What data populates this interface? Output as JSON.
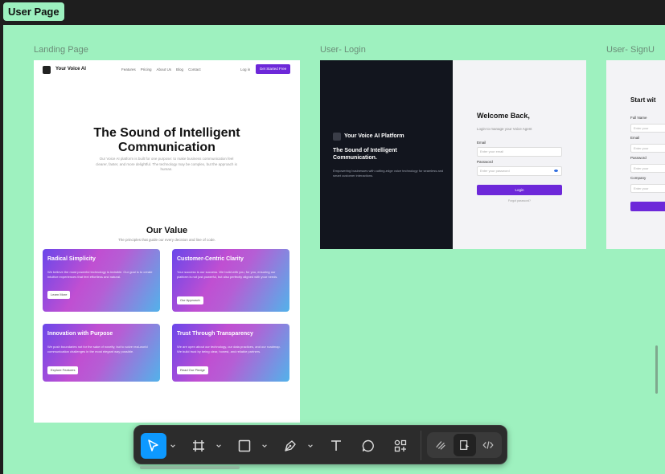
{
  "section_tag": "User Page",
  "frames": {
    "landing_label": "Landing Page",
    "login_label": "User- Login",
    "signup_label": "User- SignU"
  },
  "landing": {
    "brand": "Your Voice AI",
    "nav_links": [
      "Features",
      "Pricing",
      "About Us",
      "Blog",
      "Contact"
    ],
    "login": "Log in",
    "cta": "Get Started Free",
    "hero_line1": "The Sound of Intelligent",
    "hero_line2": "Communication",
    "hero_sub": "Our Voice AI platform is built for one purpose: to make business communication feel clearer, faster, and more delightful. The technology may be complex, but the approach is human.",
    "value_title": "Our Value",
    "value_sub": "The principles that guide our every decision and line of code.",
    "cards": [
      {
        "title": "Radical Simplicity",
        "text": "We believe the most powerful technology is invisible. Our goal is to create intuitive experiences that feel effortless and natural.",
        "button": "Learn More"
      },
      {
        "title": "Customer-Centric Clarity",
        "text": "Your success is our success. We build with you, for you, ensuring our platform is not just powerful, but also perfectly aligned with your needs.",
        "button": "Our Approach"
      },
      {
        "title": "Innovation with Purpose",
        "text": "We push boundaries not for the sake of novelty, but to solve real-world communication challenges in the most elegant way possible.",
        "button": "Explore Features"
      },
      {
        "title": "Trust Through Transparency",
        "text": "We are open about our technology, our data practices, and our roadmap. We build trust by being clear, honest, and reliable partners.",
        "button": "Read Our Pledge"
      }
    ]
  },
  "login": {
    "brand": "Your Voice AI Platform",
    "headline": "The Sound of Intelligent Communication.",
    "desc": "Empowering businesses with cutting-edge voice technology for seamless and smart customer interactions.",
    "title": "Welcome Back,",
    "subtitle": "Login to manage your Voice Agent",
    "email_label": "Email",
    "email_placeholder": "Enter your email",
    "password_label": "Password",
    "password_placeholder": "Enter your password",
    "button": "Login",
    "forgot": "Forgot password?"
  },
  "signup": {
    "title": "Start wit",
    "fields": [
      {
        "label": "Full Name",
        "placeholder": "Enter your"
      },
      {
        "label": "Email",
        "placeholder": "Enter your"
      },
      {
        "label": "Password",
        "placeholder": "Enter your"
      },
      {
        "label": "Company",
        "placeholder": "Enter your"
      }
    ]
  },
  "toolbar": {
    "tools": [
      "move-tool",
      "frame-tool",
      "shape-tool",
      "pen-tool",
      "text-tool",
      "comment-tool",
      "actions-tool"
    ],
    "modes": [
      "draw-mode",
      "design-mode",
      "dev-mode"
    ],
    "active_tool": "move-tool",
    "active_mode": "design-mode"
  },
  "colors": {
    "canvas": "#9ef1bf",
    "accent": "#0d99ff",
    "brand_purple": "#6d28d9"
  }
}
